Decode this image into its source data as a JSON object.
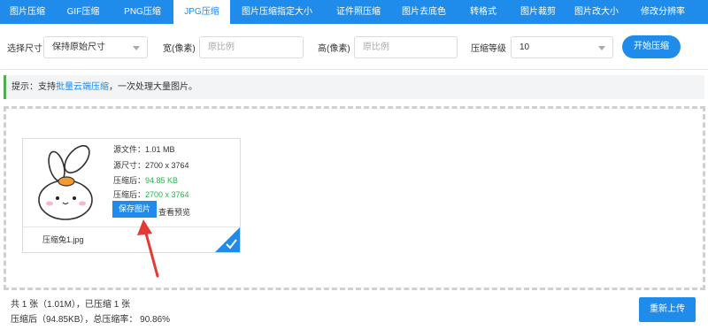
{
  "tabs": [
    {
      "label": "图片压缩"
    },
    {
      "label": "GIF压缩"
    },
    {
      "label": "PNG压缩"
    },
    {
      "label": "JPG压缩"
    },
    {
      "label": "图片压缩指定大小"
    },
    {
      "label": "证件照压缩"
    },
    {
      "label": "图片去底色"
    },
    {
      "label": "转格式"
    },
    {
      "label": "图片裁剪"
    },
    {
      "label": "图片改大小"
    },
    {
      "label": "修改分辨率"
    }
  ],
  "active_tab": "JPG压缩",
  "options": {
    "size_label": "选择尺寸",
    "size_value": "保持原始尺寸",
    "width_label": "宽(像素)",
    "width_placeholder": "原比例",
    "height_label": "高(像素)",
    "height_placeholder": "原比例",
    "level_label": "压缩等级",
    "level_value": "10",
    "start_label": "开始压缩"
  },
  "hint": {
    "prefix": "提示：支持",
    "link": "批量云端压缩",
    "suffix": "，一次处理大量图片。"
  },
  "file": {
    "src_size": "源文件：1.01 MB",
    "src_dim": "源尺寸：2700 x 3764",
    "out_size_label": "压缩后：",
    "out_size_value": "94.85 KB",
    "out_dim_label": "压缩后：",
    "out_dim_value": "2700 x 3764",
    "save_label": "保存图片",
    "preview_label": "查看预览",
    "name": "压缩兔1.jpg"
  },
  "summary": {
    "line1": "共 1 张（1.01M），已压缩 1 张",
    "line2": "压缩后（94.85KB），总压缩率： 90.86%"
  },
  "reupload_label": "重新上传",
  "colors": {
    "accent": "#1f8ceb",
    "success": "#25b84a",
    "arrow": "#e53935"
  }
}
